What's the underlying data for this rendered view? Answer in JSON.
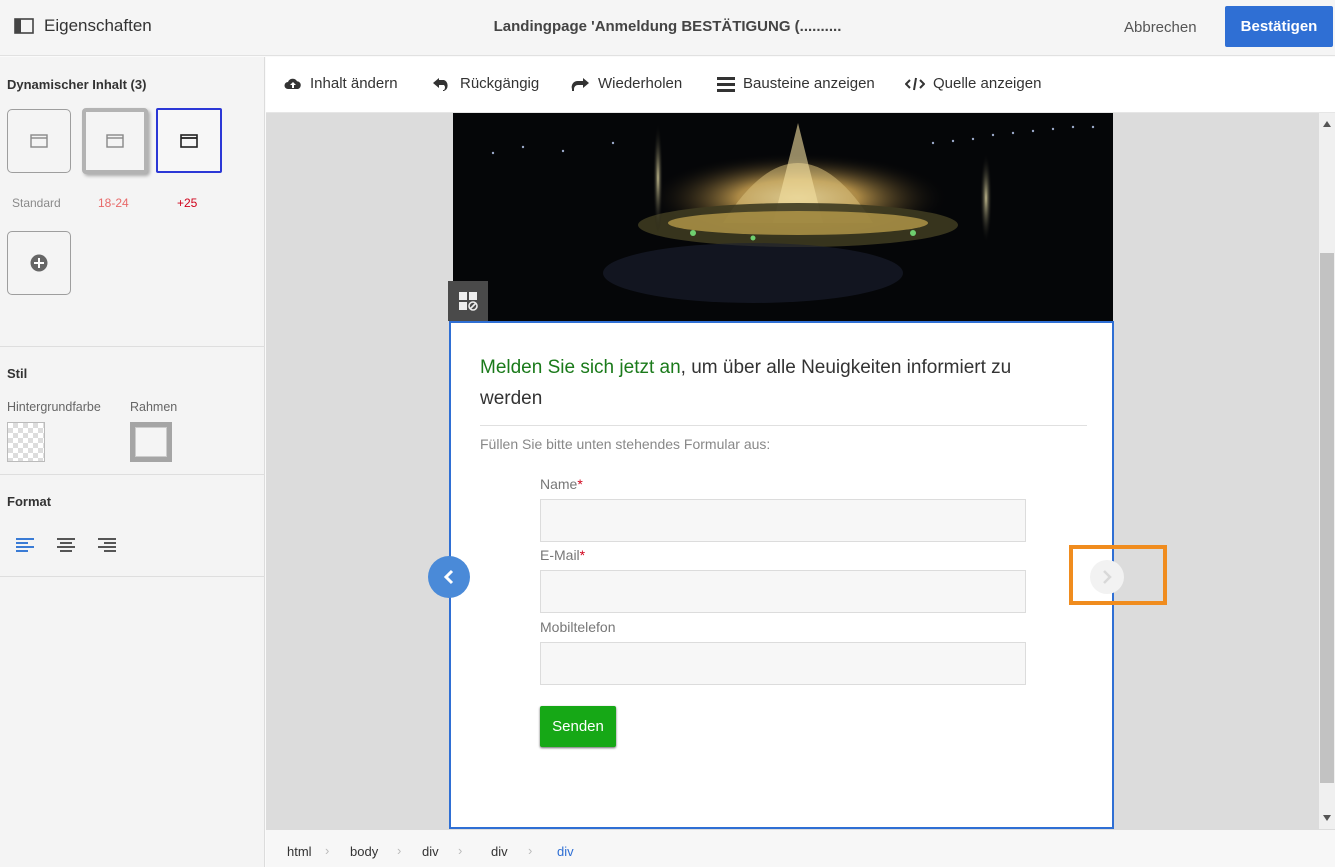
{
  "header": {
    "properties_label": "Eigenschaften",
    "page_title": "Landingpage 'Anmeldung BESTÄTIGUNG (..........",
    "cancel_label": "Abbrechen",
    "confirm_label": "Bestätigen"
  },
  "sidebar": {
    "dynamic_title": "Dynamischer Inhalt (3)",
    "variants": [
      {
        "label": "Standard",
        "color": "#8a8a8a"
      },
      {
        "label": "18-24",
        "color": "#e86a6a"
      },
      {
        "label": "+25",
        "color": "#d0021b"
      }
    ],
    "style_title": "Stil",
    "bg_color_label": "Hintergrundfarbe",
    "border_label": "Rahmen",
    "format_title": "Format",
    "alignments": [
      "align-left-icon",
      "align-center-icon",
      "align-right-icon"
    ]
  },
  "toolbar": {
    "change_content": "Inhalt ändern",
    "undo": "Rückgängig",
    "redo": "Wiederholen",
    "show_blocks": "Bausteine anzeigen",
    "show_source": "Quelle anzeigen"
  },
  "form": {
    "headline_green": "Melden Sie sich jetzt an",
    "headline_rest": ", um über alle Neuigkeiten informiert zu werden",
    "instruction": "Füllen Sie bitte unten stehendes Formular aus:",
    "name_label": "Name",
    "email_label": "E-Mail",
    "required_mark": "*",
    "mobile_label": "Mobiltelefon",
    "submit_label": "Senden"
  },
  "breadcrumb": [
    "html",
    "body",
    "div",
    "div",
    "div"
  ],
  "colors": {
    "accent": "#2f6fd4",
    "selected_variant": "#2b37d6",
    "submit": "#16a816",
    "highlight": "#f08c1e"
  }
}
